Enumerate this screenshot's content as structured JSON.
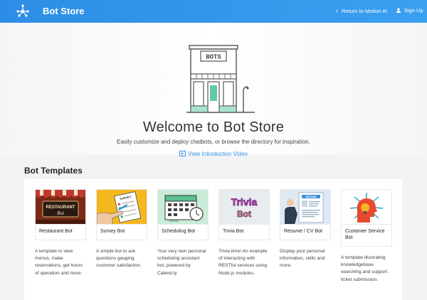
{
  "header": {
    "brand": "Bot Store",
    "return_link": "Return to Motion AI",
    "sign_up": "Sign Up",
    "logo_icon": "molecule-logo-icon",
    "accent": "#2d8de6"
  },
  "hero": {
    "store_sign": "BOTS",
    "title": "Welcome to Bot Store",
    "subtitle": "Easily customize and deploy chatbots, or browse the directory for inspiration.",
    "video_link": "View Introduction Video"
  },
  "templates": {
    "section_title": "Bot Templates",
    "cards": [
      {
        "name": "Restaurant Bot",
        "thumb_text_1": "RESTAURANT",
        "thumb_text_2": "Bot",
        "description": "A template to view menus, make reservations, get hours of operation and more."
      },
      {
        "name": "Survey Bot",
        "thumb_text_1": "SURVEY",
        "description": "A simple bot to ask questions gauging customer satisfaction."
      },
      {
        "name": "Scheduling Bot",
        "thumb_text_1": "Calendly",
        "description": "Your very own personal scheduling assistant bot, powered by Calend.ly"
      },
      {
        "name": "Trivia Bot",
        "thumb_text_1": "Trivia",
        "thumb_text_2": "Bot",
        "description": "Trivia time! An example of interacting with RESTful services using Node.js modules."
      },
      {
        "name": "Resume / CV Bot",
        "thumb_text_1": "RESUME",
        "description": "Display your personal information, skills and more."
      },
      {
        "name": "Customer Service Bot",
        "description": "A template illustrating knowledgebase searching and support ticket submission."
      }
    ]
  }
}
